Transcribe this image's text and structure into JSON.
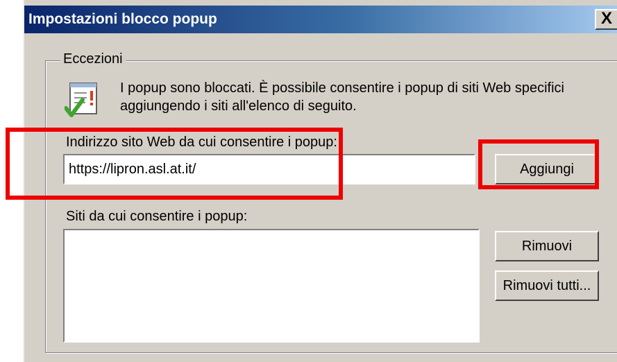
{
  "window": {
    "title": "Impostazioni blocco popup",
    "close_label": "X"
  },
  "exceptions": {
    "group_label": "Eccezioni",
    "info_text": "I popup sono bloccati. È possibile consentire i popup di siti Web specifici aggiungendo i siti all'elenco di seguito.",
    "address_label": "Indirizzo sito Web da cui consentire i popup:",
    "address_value": "https://lipron.asl.at.it/",
    "add_button": "Aggiungi",
    "allowed_sites_label": "Siti da cui consentire i popup:",
    "allowed_sites": [],
    "remove_button": "Rimuovi",
    "remove_all_button": "Rimuovi tutti..."
  },
  "colors": {
    "title_bar_start": "#0a246a",
    "title_bar_end": "#a6caf0",
    "dialog_face": "#d4d0c8",
    "highlight": "#ee0000"
  },
  "icons": {
    "info": "checklist-warning-icon"
  }
}
